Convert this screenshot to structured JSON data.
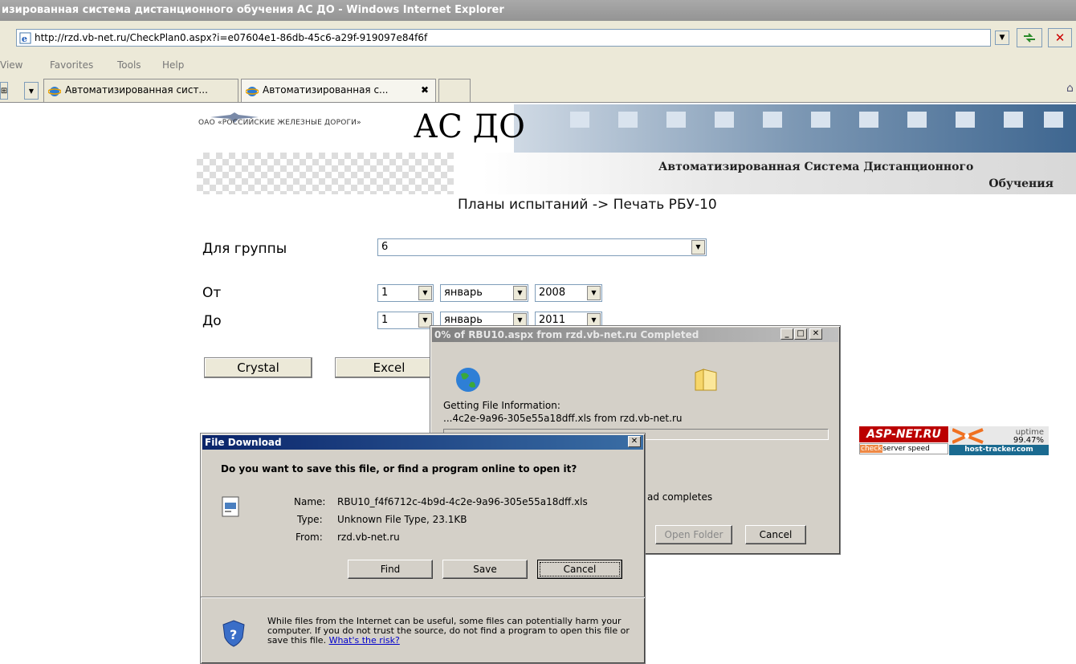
{
  "window": {
    "title": "изированная система дистанционного обучения АС ДО - Windows Internet Explorer"
  },
  "browser": {
    "url": "http://rzd.vb-net.ru/CheckPlan0.aspx?i=e07604e1-86db-45c6-a29f-919097e84f6f",
    "menu": [
      "View",
      "Favorites",
      "Tools",
      "Help"
    ],
    "tabs": [
      {
        "label": "Автоматизированная сист..."
      },
      {
        "label": "Автоматизированная с...",
        "close": "✖"
      }
    ]
  },
  "header": {
    "logo_text": "ОАО «РОССИЙСКИЕ ЖЕЛЕЗНЫЕ ДОРОГИ»",
    "logo_prefix": "ОАО",
    "title": "АС ДО",
    "subtitle_line1": "Автоматизированная Система Дистанционного",
    "subtitle_line2": "Обучения"
  },
  "page": {
    "breadcrumb": "Планы испытаний -> Печать РБУ-10",
    "group_label": "Для группы",
    "group_value": "6",
    "from_label": "От",
    "from": {
      "day": "1",
      "month": "январь",
      "year": "2008"
    },
    "to_label": "До",
    "to": {
      "day": "1",
      "month": "январь",
      "year": "2011"
    },
    "btn_crystal": "Crystal",
    "btn_excel": "Excel"
  },
  "badges": {
    "aspnet": "ASP-NET.RU",
    "check": "check",
    "server_speed": "server speed",
    "uptime_label": "uptime",
    "uptime_value": "99.47%",
    "host_tracker": "host-tracker.com"
  },
  "progress_dialog": {
    "title": "0% of RBU10.aspx from rzd.vb-net.ru Completed",
    "status": "Getting File Information:",
    "file_line": "...4c2e-9a96-305e55a18dff.xls from rzd.vb-net.ru",
    "close_text": "ad completes",
    "open_folder": "Open Folder",
    "cancel": "Cancel",
    "progress": 0
  },
  "download_dialog": {
    "title": "File Download",
    "question": "Do you want to save this file, or find a program online to open it?",
    "name_label": "Name:",
    "name_value": "RBU10_f4f6712c-4b9d-4c2e-9a96-305e55a18dff.xls",
    "type_label": "Type:",
    "type_value": "Unknown File Type, 23.1KB",
    "from_label": "From:",
    "from_value": "rzd.vb-net.ru",
    "find": "Find",
    "save": "Save",
    "cancel": "Cancel",
    "warning": "While files from the Internet can be useful, some files can potentially harm your computer. If you do not trust the source, do not find a program to open this file or save this file.",
    "risk_link": "What's the risk?"
  }
}
